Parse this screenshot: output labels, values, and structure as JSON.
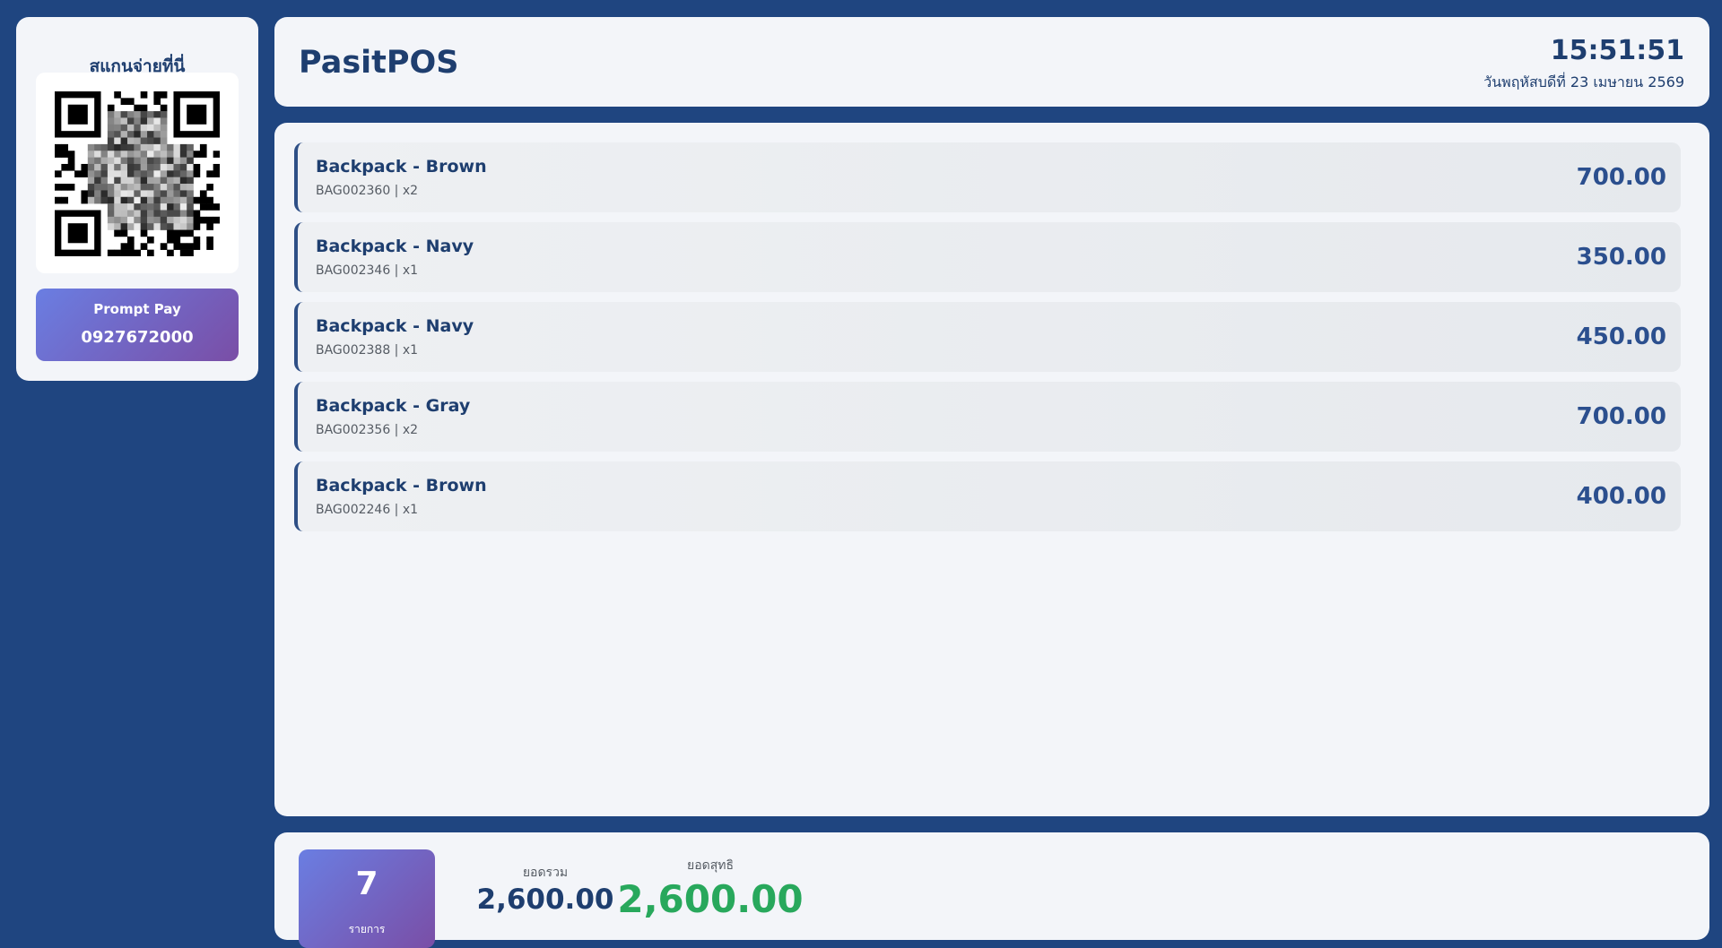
{
  "payment": {
    "scan_title": "สแกนจ่ายที่นี่",
    "method_label": "Prompt Pay",
    "phone": "0927672000"
  },
  "header": {
    "brand": "PasitPOS",
    "time": "15:51:51",
    "date": "วันพฤหัสบดีที่ 23 เมษายน 2569"
  },
  "items": [
    {
      "name": "Backpack - Brown",
      "sku_qty": "BAG002360 | x2",
      "price": "700.00"
    },
    {
      "name": "Backpack - Navy",
      "sku_qty": "BAG002346 | x1",
      "price": "350.00"
    },
    {
      "name": "Backpack - Navy",
      "sku_qty": "BAG002388 | x1",
      "price": "450.00"
    },
    {
      "name": "Backpack - Gray",
      "sku_qty": "BAG002356 | x2",
      "price": "700.00"
    },
    {
      "name": "Backpack - Brown",
      "sku_qty": "BAG002246 | x1",
      "price": "400.00"
    }
  ],
  "summary": {
    "count": "7",
    "count_label": "รายการ",
    "total_label": "ยอดรวม",
    "total_value": "2,600.00",
    "net_label": "ยอดสุทธิ",
    "net_value": "2,600.00"
  },
  "colors": {
    "background": "#1f4580",
    "panel": "#f3f5f9",
    "primary_text": "#1e3e6f",
    "price": "#2b4f8e",
    "net_total": "#28a85c",
    "gradient_start": "#6a7ee2",
    "gradient_end": "#7a4ea6"
  },
  "icons": {
    "qr": "qr-code-icon"
  }
}
